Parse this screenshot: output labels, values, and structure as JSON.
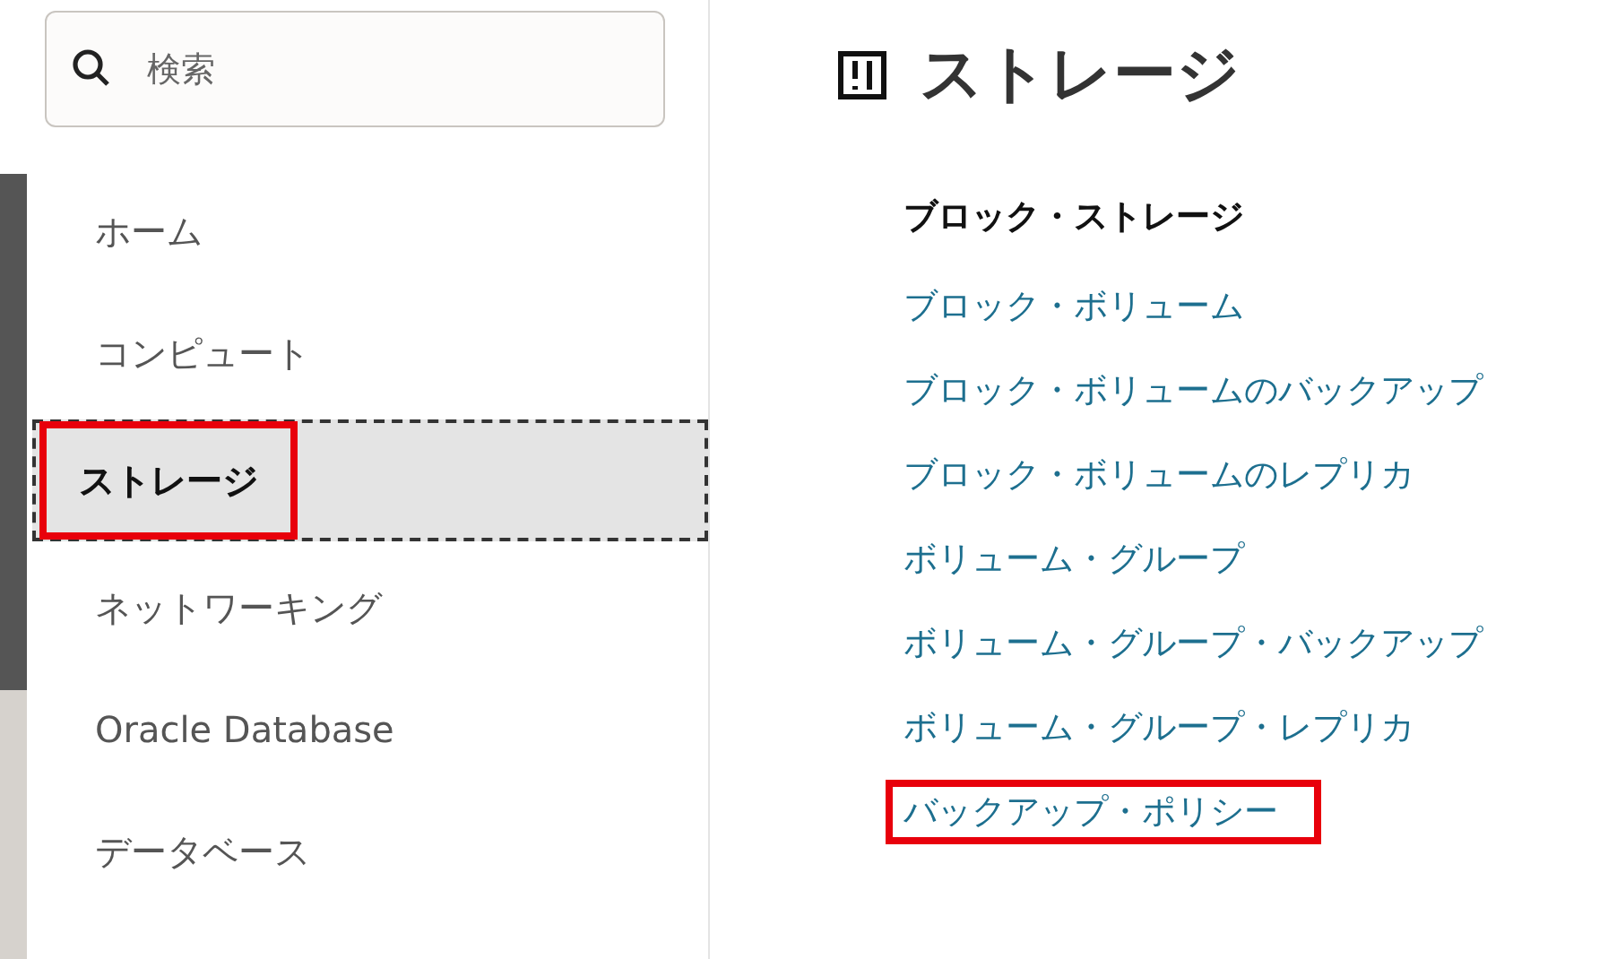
{
  "search": {
    "placeholder": "検索"
  },
  "sidebar": {
    "items": [
      {
        "label": "ホーム",
        "selected": false,
        "highlighted": false
      },
      {
        "label": "コンピュート",
        "selected": false,
        "highlighted": false
      },
      {
        "label": "ストレージ",
        "selected": true,
        "highlighted": true
      },
      {
        "label": "ネットワーキング",
        "selected": false,
        "highlighted": false
      },
      {
        "label": "Oracle Database",
        "selected": false,
        "highlighted": false
      },
      {
        "label": "データベース",
        "selected": false,
        "highlighted": false
      }
    ]
  },
  "page": {
    "title": "ストレージ",
    "section": {
      "heading": "ブロック・ストレージ",
      "links": [
        {
          "label": "ブロック・ボリューム",
          "highlighted": false
        },
        {
          "label": "ブロック・ボリュームのバックアップ",
          "highlighted": false
        },
        {
          "label": "ブロック・ボリュームのレプリカ",
          "highlighted": false
        },
        {
          "label": "ボリューム・グループ",
          "highlighted": false
        },
        {
          "label": "ボリューム・グループ・バックアップ",
          "highlighted": false
        },
        {
          "label": "ボリューム・グループ・レプリカ",
          "highlighted": false
        },
        {
          "label": "バックアップ・ポリシー",
          "highlighted": true
        }
      ]
    }
  }
}
